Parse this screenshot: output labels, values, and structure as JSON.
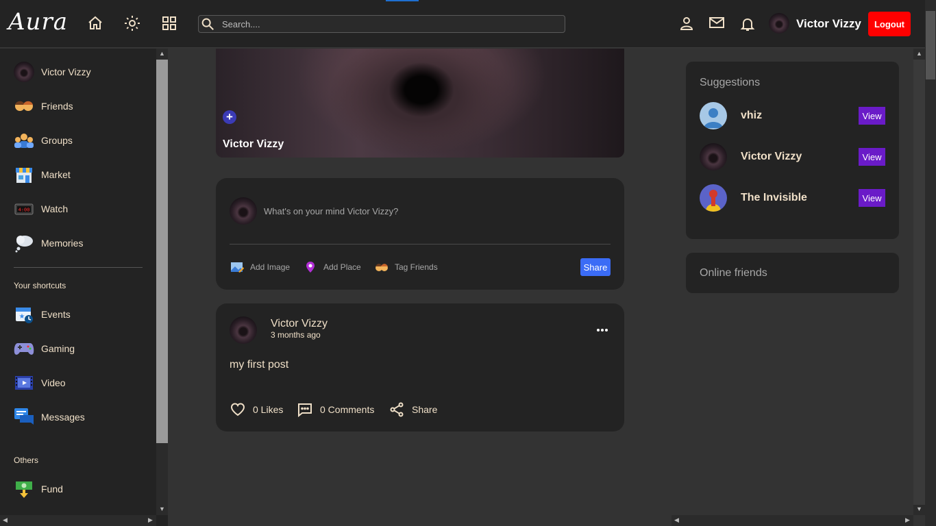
{
  "app": {
    "logo": "Aura"
  },
  "header": {
    "search_placeholder": "Search....",
    "user_name": "Victor Vizzy",
    "logout_label": "Logout"
  },
  "sidebar": {
    "items": [
      {
        "label": "Victor Vizzy",
        "icon": "avatar"
      },
      {
        "label": "Friends",
        "icon": "friends-icon"
      },
      {
        "label": "Groups",
        "icon": "groups-icon"
      },
      {
        "label": "Market",
        "icon": "market-icon"
      },
      {
        "label": "Watch",
        "icon": "watch-icon"
      },
      {
        "label": "Memories",
        "icon": "memories-icon"
      }
    ],
    "shortcuts_heading": "Your shortcuts",
    "shortcuts": [
      {
        "label": "Events",
        "icon": "events-icon"
      },
      {
        "label": "Gaming",
        "icon": "gaming-icon"
      },
      {
        "label": "Video",
        "icon": "video-icon"
      },
      {
        "label": "Messages",
        "icon": "messages-icon"
      }
    ],
    "others_heading": "Others",
    "others": [
      {
        "label": "Fund",
        "icon": "fund-icon"
      }
    ]
  },
  "cover": {
    "name": "Victor Vizzy"
  },
  "composer": {
    "placeholder": "What's on your mind Victor Vizzy?",
    "add_image": "Add Image",
    "add_place": "Add Place",
    "tag_friends": "Tag Friends",
    "share_label": "Share"
  },
  "post": {
    "author": "Victor Vizzy",
    "time": "3 months ago",
    "text": "my first post",
    "likes": "0 Likes",
    "comments": "0 Comments",
    "share": "Share"
  },
  "suggestions": {
    "title": "Suggestions",
    "people": [
      {
        "name": "vhiz",
        "button": "View"
      },
      {
        "name": "Victor Vizzy",
        "button": "View"
      },
      {
        "name": "The Invisible",
        "button": "View"
      }
    ]
  },
  "online_friends": {
    "title": "Online friends"
  },
  "colors": {
    "accent_logout": "#ff0000",
    "view_button": "#6a1bc8",
    "share_button": "#3b6cf6",
    "text": "#f0e0c8"
  }
}
